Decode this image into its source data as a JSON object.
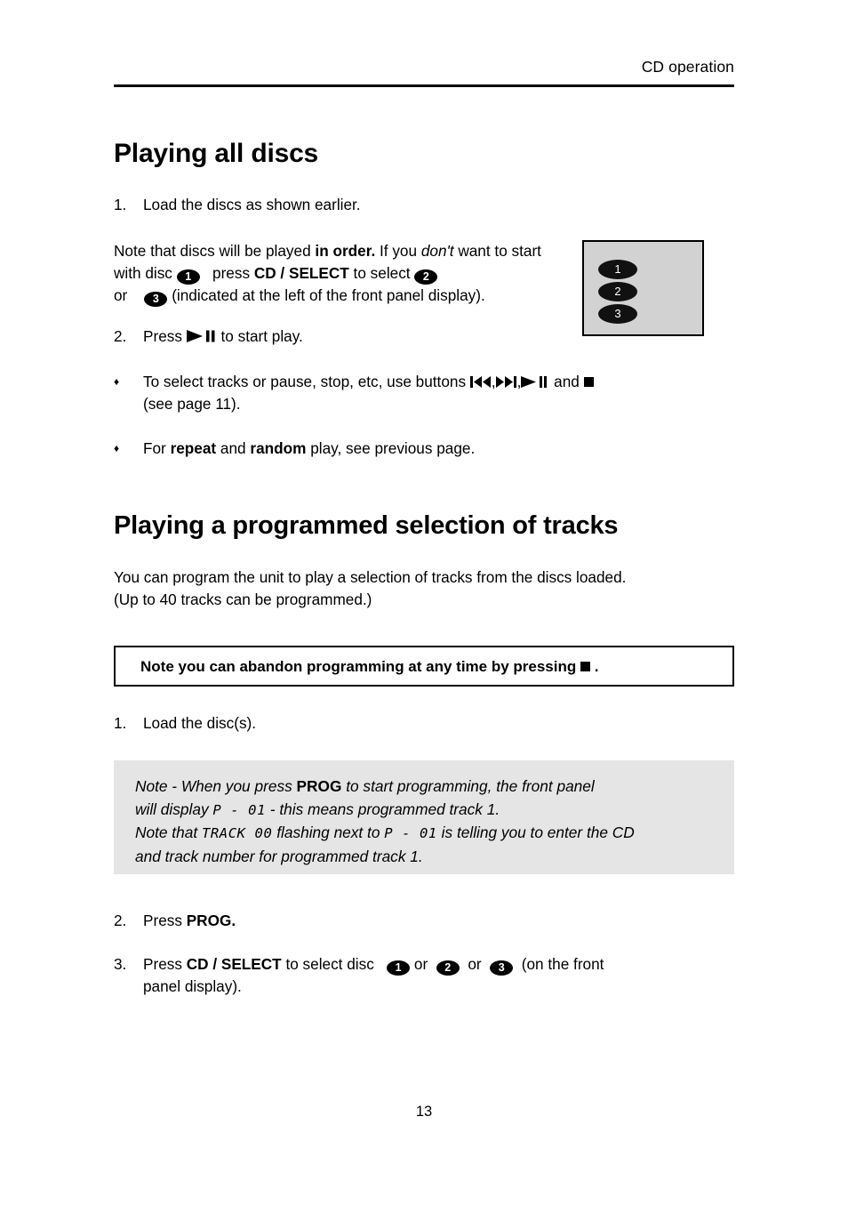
{
  "header": {
    "running_head": "CD operation"
  },
  "sections": {
    "playing_all_discs": {
      "heading": "Playing all discs",
      "step1": {
        "number": "1.",
        "text": "Load the discs as shown earlier."
      },
      "note_paragraph": {
        "part1": "Note that discs will be played ",
        "bold_in_order": "in order.",
        "part2": " If you ",
        "italic_dont": "don't",
        "part3": " want to start with disc ",
        "disc1": "1",
        "part4": "press ",
        "bold_cd_select": "CD / SELECT",
        "part5": " to select ",
        "disc2": "2",
        "part6": "or",
        "disc3": "3",
        "part7": "(indicated at the left of the front panel display)."
      },
      "step2": {
        "number": "2.",
        "text_before": "Press ",
        "text_after": " to start play."
      },
      "bullet1": {
        "marker": "♦",
        "text_before": "To select tracks or pause, stop, etc, use buttons ",
        "text_after": " and ",
        "line2": "(see page 11)."
      },
      "bullet2": {
        "marker": "♦",
        "part1": "For ",
        "bold_repeat": "repeat",
        "part2": " and ",
        "bold_random": "random",
        "part3": " play, see previous page."
      }
    },
    "programmed_selection": {
      "heading": "Playing a programmed selection of tracks",
      "intro_line1": "You can program the unit to play a selection of tracks from the discs loaded.",
      "intro_line2": "(Up to 40 tracks can be programmed.)",
      "abandon_note": {
        "text_before": "Note you can abandon programming at any time by pressing ",
        "text_after": " ."
      },
      "step1": {
        "number": "1.",
        "text": "Load the disc(s)."
      },
      "prog_note": {
        "line1_part1": "Note - When you press ",
        "line1_bold": "PROG",
        "line1_part2": " to start programming, the front panel",
        "line2_part1": "will display ",
        "line2_lcd": "P - 01",
        "line2_part2": " - this means programmed track 1.",
        "line3_part1": "Note that ",
        "line3_lcd1": "TRACK 00",
        "line3_part2": " flashing next to ",
        "line3_lcd2": "P - 01",
        "line3_part3": " is telling you to enter the CD",
        "line4": "and track number for programmed track 1."
      },
      "step2": {
        "number": "2.",
        "text_before": "Press ",
        "bold": "PROG."
      },
      "step3": {
        "number": "3.",
        "part1": "Press ",
        "bold_cd_select": "CD / SELECT",
        "part2": " to select disc ",
        "disc1": "1",
        "or1": "or",
        "disc2": "2",
        "or2": "or",
        "disc3": "3",
        "part3": "(on the front",
        "line2": "panel display)."
      }
    }
  },
  "front_panel_display": {
    "discs": [
      "1",
      "2",
      "3"
    ]
  },
  "footer": {
    "page_number": "13"
  },
  "colors": {
    "text": "#000000",
    "page_background": "#ffffff",
    "panel_background": "#d2d2d2",
    "note_block_background": "#e5e5e5"
  }
}
